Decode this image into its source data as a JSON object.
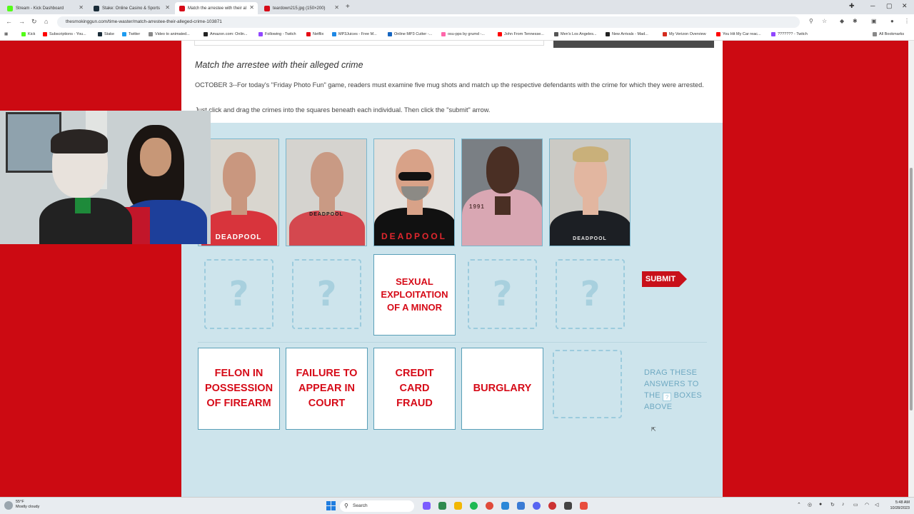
{
  "browser": {
    "tabs": [
      {
        "label": "Stream - Kick Dashboard",
        "color": "#53fc18"
      },
      {
        "label": "Stake: Online Casino & Sports",
        "color": "#1a2c38"
      },
      {
        "label": "Match the arrestee with their al",
        "color": "#d60b18"
      },
      {
        "label": "teardown215.jpg (150×200)",
        "color": "#d60b18"
      }
    ],
    "new_tab": "+",
    "url": "thesmokinggun.com/time-waster/match-arrestee-their-alleged-crime-103871",
    "bookmarks": [
      {
        "label": "Kick",
        "color": "#53fc18"
      },
      {
        "label": "Subscriptions - You...",
        "color": "#ff0000"
      },
      {
        "label": "Stake",
        "color": "#1a2c38"
      },
      {
        "label": "Twitter",
        "color": "#1d9bf0"
      },
      {
        "label": "Video to animated...",
        "color": "#888888"
      },
      {
        "label": "Amazon.com: Onlin...",
        "color": "#222222"
      },
      {
        "label": "Following - Twitch",
        "color": "#9146ff"
      },
      {
        "label": "Netflix",
        "color": "#e50914"
      },
      {
        "label": "MP3Juices - Free M...",
        "color": "#1e88e5"
      },
      {
        "label": "Online MP3 Cutter -...",
        "color": "#1565c0"
      },
      {
        "label": "osu-pps by grumd -...",
        "color": "#ff66aa"
      },
      {
        "label": "John From Tennesse...",
        "color": "#ff0000"
      },
      {
        "label": "Men's Los Angeles...",
        "color": "#555555"
      },
      {
        "label": "New Arrivals - Mad...",
        "color": "#222222"
      },
      {
        "label": "My Verizon Overview",
        "color": "#d52b1e"
      },
      {
        "label": "You Hit My Car reac...",
        "color": "#ff0000"
      },
      {
        "label": "??????? - Twitch",
        "color": "#9146ff"
      }
    ],
    "all_bookmarks": "All Bookmarks"
  },
  "game": {
    "title": "Match the arrestee with their alleged crime",
    "intro": "OCTOBER 3--For today's \"Friday Photo Fun\" game, readers must examine five mug shots and match up the respective defendants with the crime for which they were arrested.",
    "instructions": "Just click and drag the crimes into the squares beneath each individual. Then click the \"submit\" arrow.",
    "mugshots": [
      {
        "shirt_text": "DEADPOOL",
        "shirt_color": "#d8343c",
        "text_color": "#ffffff",
        "skin": "#c9977f",
        "bg": "#d9d6cf",
        "hair": "#6b5a46"
      },
      {
        "shirt_text": "DEADPOOL",
        "shirt_color": "#d4484f",
        "text_color": "#1a1a1a",
        "skin": "#c99a84",
        "bg": "#d5d3cf",
        "hair": "#8b7a63"
      },
      {
        "shirt_text": "DEADPOOL",
        "shirt_color": "#111111",
        "text_color": "#e2272e",
        "skin": "#d8a288",
        "bg": "#e3e0dc",
        "hair": "#e3e0dc"
      },
      {
        "shirt_text": "1991",
        "shirt_color": "#d9a7b3",
        "text_color": "#5a3a3a",
        "skin": "#4a2f24",
        "bg": "#7a7f84",
        "hair": "#2a1d18"
      },
      {
        "shirt_text": "DEADPOOL",
        "shirt_color": "#1c1f24",
        "text_color": "#e6e6e6",
        "skin": "#e2b6a0",
        "bg": "#cbcac5",
        "hair": "#c9b07a"
      }
    ],
    "slot_placeholder": "?",
    "placed_answer": "SEXUAL EXPLOITATION OF A MINOR",
    "answers": [
      "FELON IN POSSESSION OF FIREARM",
      "FAILURE TO APPEAR IN COURT",
      "CREDIT CARD FRAUD",
      "BURGLARY"
    ],
    "submit_label": "SUBMIT",
    "drag_hint_before": "DRAG THESE ANSWERS TO THE",
    "drag_hint_after": "BOXES ABOVE"
  },
  "taskbar": {
    "weather_temp": "55°F",
    "weather_desc": "Mostly cloudy",
    "search": "Search",
    "time": "5:48 AM",
    "date": "10/28/2023"
  }
}
